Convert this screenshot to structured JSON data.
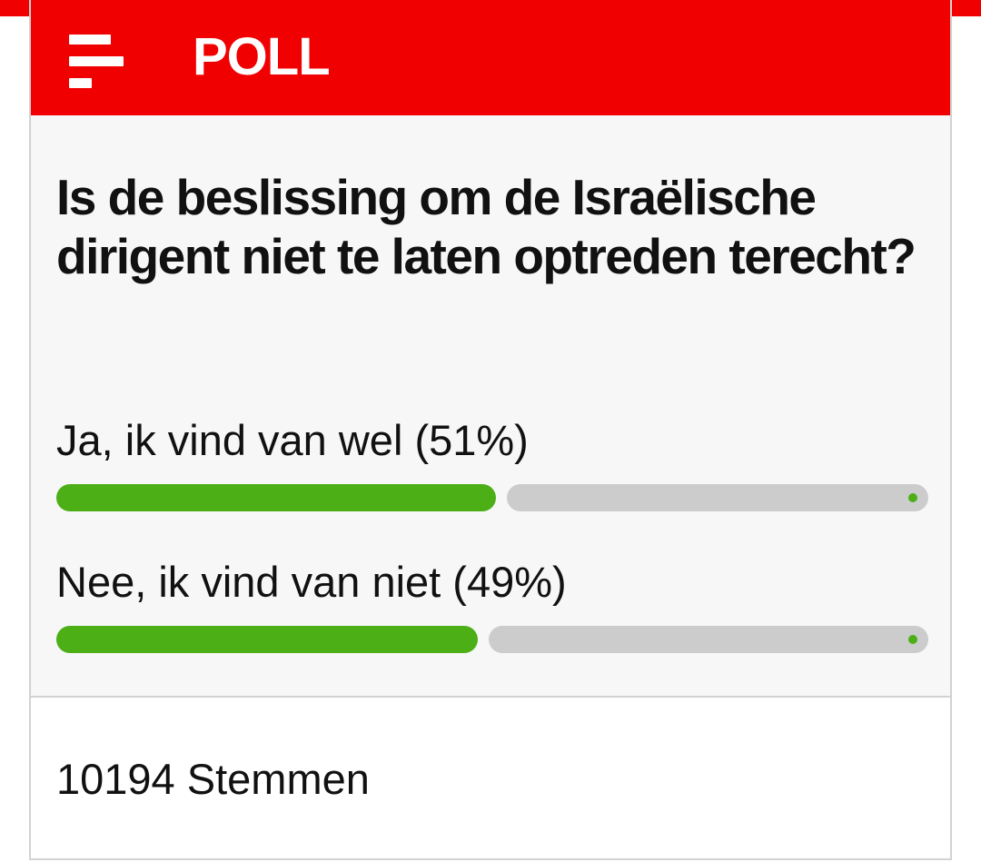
{
  "header": {
    "title": "POLL",
    "logo_icon": "news-logo-icon",
    "background_color": "#f00000"
  },
  "question": "Is de beslissing om de Israëlische dirigent niet te laten optreden terecht?",
  "options": [
    {
      "label": "Ja, ik vind van wel (51%)",
      "percent": 51
    },
    {
      "label": "Nee, ik vind van niet (49%)",
      "percent": 49
    }
  ],
  "colors": {
    "bar_fill": "#4caf16",
    "bar_track": "#cccccc",
    "body_background": "#f7f7f7"
  },
  "footer": {
    "votes": "10194 Stemmen"
  }
}
